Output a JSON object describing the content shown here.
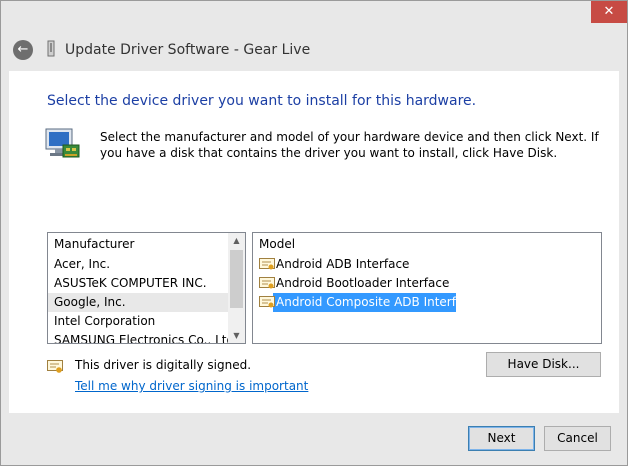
{
  "window": {
    "title": "Update Driver Software - Gear Live",
    "close_label": "✕"
  },
  "header": {
    "back_label": "←"
  },
  "main": {
    "title": "Select the device driver you want to install for this hardware.",
    "description": "Select the manufacturer and model of your hardware device and then click Next. If you have a disk that contains the driver you want to install, click Have Disk."
  },
  "manufacturer": {
    "header": "Manufacturer",
    "items": [
      "Acer, Inc.",
      "ASUSTeK COMPUTER INC.",
      "Google, Inc.",
      "Intel Corporation",
      "SAMSUNG Electronics Co., Ltd."
    ],
    "selected": "Google, Inc."
  },
  "model": {
    "header": "Model",
    "items": [
      "Android ADB Interface",
      "Android Bootloader Interface",
      "Android Composite ADB Interface"
    ],
    "selected": "Android Composite ADB Interface"
  },
  "signing": {
    "status": "This driver is digitally signed.",
    "link": "Tell me why driver signing is important"
  },
  "buttons": {
    "have_disk": "Have Disk...",
    "next": "Next",
    "cancel": "Cancel"
  },
  "colors": {
    "title_blue": "#1c3fa4",
    "selection": "#3399ff",
    "link": "#0066cc",
    "close_red": "#c74b44"
  }
}
